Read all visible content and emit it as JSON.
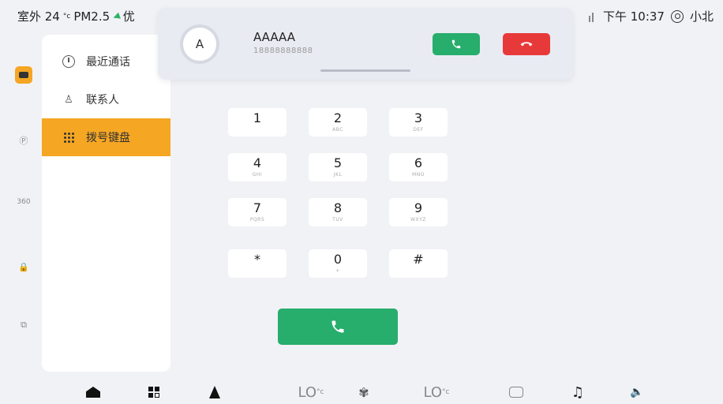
{
  "status": {
    "outside_temp": "室外 24",
    "temp_unit": "°c",
    "pm": "PM2.5",
    "air_quality": "优",
    "time": "下午 10:37",
    "user": "小北"
  },
  "call": {
    "avatar_letter": "A",
    "name": "AAAAA",
    "number": "18888888888"
  },
  "menu": {
    "items": [
      {
        "label": "最近通话",
        "icon": "clock-icon"
      },
      {
        "label": "联系人",
        "icon": "person-icon"
      },
      {
        "label": "拨号键盘",
        "icon": "dialpad-icon"
      }
    ]
  },
  "keypad": {
    "keys": [
      {
        "num": "1",
        "sub": ""
      },
      {
        "num": "2",
        "sub": "ABC"
      },
      {
        "num": "3",
        "sub": "DEF"
      },
      {
        "num": "4",
        "sub": "GHI"
      },
      {
        "num": "5",
        "sub": "JKL"
      },
      {
        "num": "6",
        "sub": "MNO"
      },
      {
        "num": "7",
        "sub": "PQRS"
      },
      {
        "num": "8",
        "sub": "TUV"
      },
      {
        "num": "9",
        "sub": "WXYZ"
      },
      {
        "num": "*",
        "sub": ""
      },
      {
        "num": "0",
        "sub": "+"
      },
      {
        "num": "#",
        "sub": ""
      }
    ]
  },
  "dock": {
    "temp_left": "LO",
    "temp_right": "LO",
    "temp_unit": "°c"
  },
  "colors": {
    "accent": "#f5a623",
    "accept": "#27ad6c",
    "decline": "#e8393a"
  }
}
